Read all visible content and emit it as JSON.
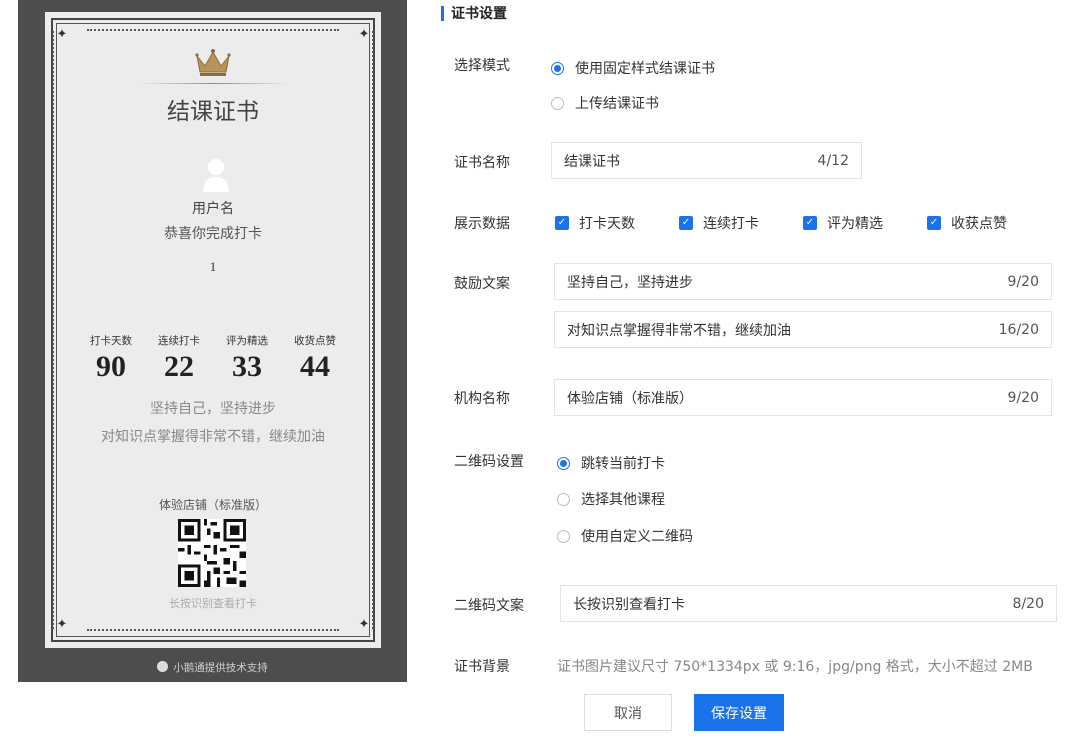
{
  "preview": {
    "title": "结课证书",
    "username": "用户名",
    "congrats": "恭喜你完成打卡",
    "count": "1",
    "stats": [
      {
        "label": "打卡天数",
        "value": "90"
      },
      {
        "label": "连续打卡",
        "value": "22"
      },
      {
        "label": "评为精选",
        "value": "33"
      },
      {
        "label": "收货点赞",
        "value": "44"
      }
    ],
    "encourage1": "坚持自己，坚持进步",
    "encourage2": "对知识点掌握得非常不错，继续加油",
    "org": "体验店铺（标准版）",
    "qr_caption": "长按识别查看打卡",
    "support": "小鹅通提供技术支持"
  },
  "form": {
    "section_title": "证书设置",
    "mode": {
      "label": "选择模式",
      "options": [
        {
          "label": "使用固定样式结课证书",
          "selected": true
        },
        {
          "label": "上传结课证书",
          "selected": false
        }
      ]
    },
    "name": {
      "label": "证书名称",
      "value": "结课证书",
      "counter": "4/12"
    },
    "display": {
      "label": "展示数据",
      "options": [
        {
          "label": "打卡天数",
          "checked": true
        },
        {
          "label": "连续打卡",
          "checked": true
        },
        {
          "label": "评为精选",
          "checked": true
        },
        {
          "label": "收获点赞",
          "checked": true
        }
      ]
    },
    "encourage": {
      "label": "鼓励文案",
      "fields": [
        {
          "value": "坚持自己，坚持进步",
          "counter": "9/20"
        },
        {
          "value": "对知识点掌握得非常不错，继续加油",
          "counter": "16/20"
        }
      ]
    },
    "org": {
      "label": "机构名称",
      "value": "体验店铺（标准版）",
      "counter": "9/20"
    },
    "qr": {
      "label": "二维码设置",
      "options": [
        {
          "label": "跳转当前打卡",
          "selected": true
        },
        {
          "label": "选择其他课程",
          "selected": false
        },
        {
          "label": "使用自定义二维码",
          "selected": false
        }
      ]
    },
    "qr_text": {
      "label": "二维码文案",
      "value": "长按识别查看打卡",
      "counter": "8/20"
    },
    "background": {
      "label": "证书背景",
      "hint": "证书图片建议尺寸 750*1334px 或 9:16，jpg/png 格式，大小不超过 2MB"
    },
    "buttons": {
      "cancel": "取消",
      "save": "保存设置"
    }
  },
  "colors": {
    "accent": "#1a73e8",
    "preview_bg": "#4d4d4d",
    "paper": "#ececec"
  }
}
